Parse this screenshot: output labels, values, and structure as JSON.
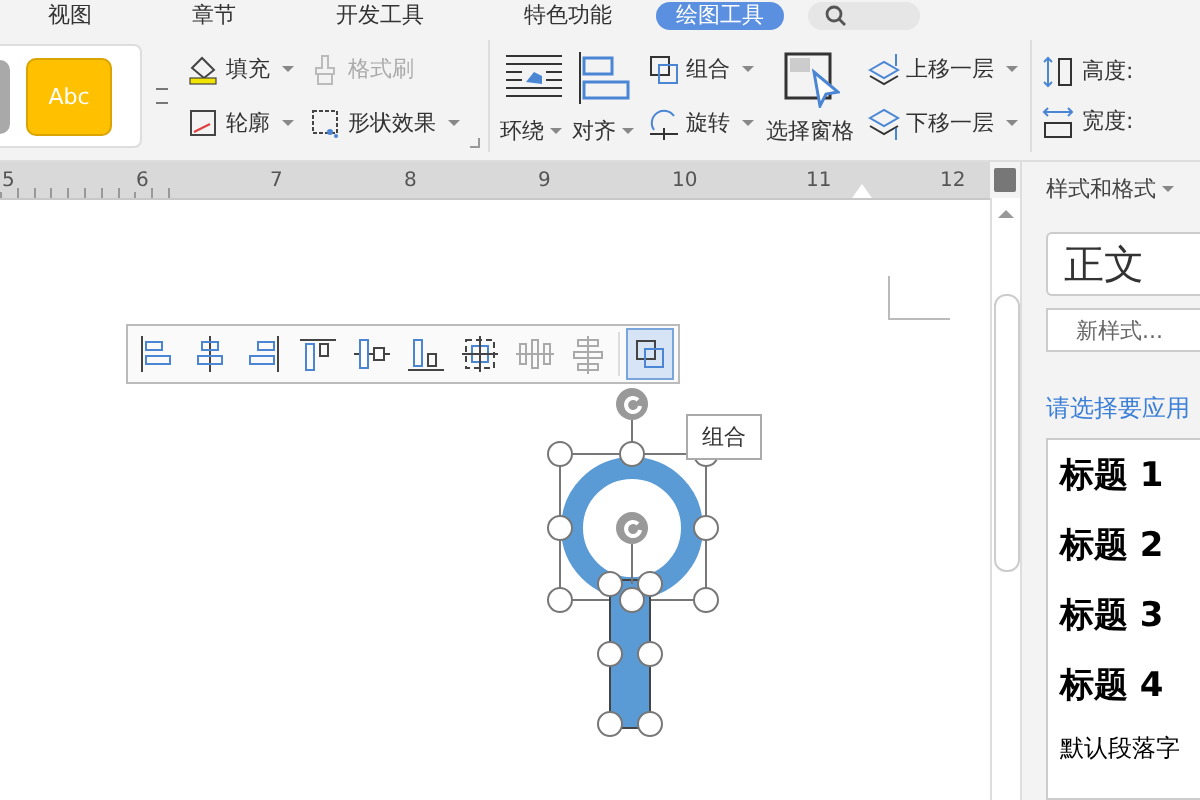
{
  "tabs": [
    {
      "label": "视图",
      "selected": false
    },
    {
      "label": "章节",
      "selected": false
    },
    {
      "label": "开发工具",
      "selected": false
    },
    {
      "label": "特色功能",
      "selected": false
    },
    {
      "label": "绘图工具",
      "selected": true
    }
  ],
  "ribbon": {
    "gallery": {
      "sample": "Abc"
    },
    "format_columns": [
      [
        {
          "label": "填充",
          "kind": "fill",
          "dropdown": true,
          "disabled": false
        },
        {
          "label": "轮廓",
          "kind": "outline",
          "dropdown": true,
          "disabled": false
        }
      ],
      [
        {
          "label": "格式刷",
          "kind": "painter",
          "dropdown": false,
          "disabled": true
        },
        {
          "label": "形状效果",
          "kind": "effects",
          "dropdown": true,
          "disabled": false
        }
      ]
    ],
    "arrange": [
      {
        "kind": "large",
        "label": "环绕",
        "dropdown": true
      },
      {
        "kind": "large",
        "label": "对齐",
        "dropdown": true
      },
      {
        "kind": "column",
        "items": [
          {
            "label": "组合",
            "dropdown": true
          },
          {
            "label": "旋转",
            "dropdown": true
          }
        ]
      },
      {
        "kind": "large",
        "label": "选择窗格",
        "dropdown": false
      },
      {
        "kind": "column",
        "items": [
          {
            "label": "上移一层",
            "dropdown": true
          },
          {
            "label": "下移一层",
            "dropdown": true
          }
        ]
      }
    ],
    "size": [
      {
        "label": "高度:"
      },
      {
        "label": "宽度:"
      }
    ]
  },
  "ruler": [
    "5",
    "6",
    "7",
    "8",
    "9",
    "10",
    "11",
    "12"
  ],
  "float_toolbar": [
    {
      "kind": "align-left",
      "disabled": false,
      "selected": false
    },
    {
      "kind": "align-center",
      "disabled": false,
      "selected": false
    },
    {
      "kind": "align-right",
      "disabled": false,
      "selected": false
    },
    {
      "kind": "align-top",
      "disabled": false,
      "selected": false
    },
    {
      "kind": "align-middle",
      "disabled": false,
      "selected": false
    },
    {
      "kind": "align-bottom",
      "disabled": false,
      "selected": false
    },
    {
      "kind": "center-both",
      "disabled": false,
      "selected": false
    },
    {
      "kind": "distribute-h",
      "disabled": true,
      "selected": false
    },
    {
      "kind": "distribute-v",
      "disabled": true,
      "selected": false
    },
    {
      "kind": "group",
      "disabled": false,
      "selected": true
    }
  ],
  "tooltip": "组合",
  "panel": {
    "title": "样式和格式",
    "current_style": "正文",
    "new_style_button": "新样式...",
    "prompt": "请选择要应用",
    "styles": [
      {
        "label": "标题 1",
        "kind": "heading"
      },
      {
        "label": "标题 2",
        "kind": "heading"
      },
      {
        "label": "标题 3",
        "kind": "heading"
      },
      {
        "label": "标题 4",
        "kind": "heading"
      },
      {
        "label": "默认段落字",
        "kind": "body"
      }
    ]
  }
}
